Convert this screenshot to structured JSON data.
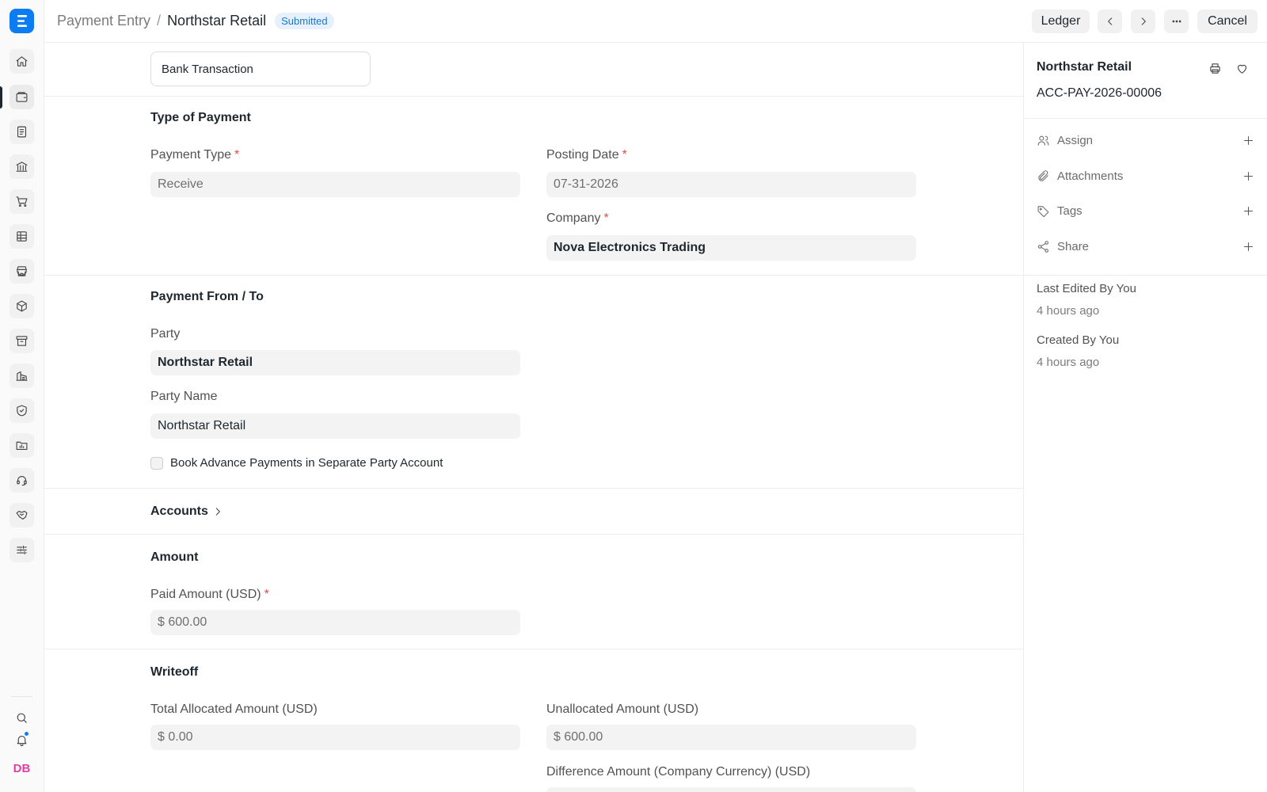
{
  "app": {
    "logo_letter": "E",
    "user_initials": "DB"
  },
  "rail": {
    "items": [
      {
        "icon": "home-icon"
      },
      {
        "icon": "wallet-icon"
      },
      {
        "icon": "document-icon"
      },
      {
        "icon": "bank-icon"
      },
      {
        "icon": "cart-icon"
      },
      {
        "icon": "table-icon"
      },
      {
        "icon": "store-icon"
      },
      {
        "icon": "package-icon"
      },
      {
        "icon": "archive-icon"
      },
      {
        "icon": "building-icon"
      },
      {
        "icon": "shield-icon"
      },
      {
        "icon": "folder-chart-icon"
      },
      {
        "icon": "headset-icon"
      },
      {
        "icon": "handshake-icon"
      },
      {
        "icon": "sliders-icon"
      }
    ],
    "bottom": [
      "search-icon",
      "bell-icon"
    ]
  },
  "header": {
    "breadcrumb_parent": "Payment Entry",
    "breadcrumb_separator": "/",
    "breadcrumb_current": "Northstar Retail",
    "status_badge": "Submitted",
    "ledger_label": "Ledger",
    "cancel_label": "Cancel"
  },
  "form": {
    "bank_transaction": "Bank Transaction",
    "type_of_payment": {
      "title": "Type of Payment",
      "payment_type_label": "Payment Type",
      "payment_type_value": "Receive",
      "posting_date_label": "Posting Date",
      "posting_date_value": "07-31-2026",
      "company_label": "Company",
      "company_value": "Nova Electronics Trading",
      "required_mark": "*"
    },
    "payment_from_to": {
      "title": "Payment From / To",
      "party_label": "Party",
      "party_value": "Northstar Retail",
      "party_name_label": "Party Name",
      "party_name_value": "Northstar Retail",
      "book_advance_label": "Book Advance Payments in Separate Party Account",
      "book_advance_checked": false
    },
    "accounts": {
      "title": "Accounts"
    },
    "amount": {
      "title": "Amount",
      "paid_amount_label": "Paid Amount (USD)",
      "paid_amount_value": "$ 600.00"
    },
    "writeoff": {
      "title": "Writeoff",
      "total_allocated_label": "Total Allocated Amount (USD)",
      "total_allocated_value": "$ 0.00",
      "unallocated_label": "Unallocated Amount (USD)",
      "unallocated_value": "$ 600.00",
      "difference_label": "Difference Amount (Company Currency) (USD)"
    }
  },
  "sidebar": {
    "title": "Northstar Retail",
    "doc_id": "ACC-PAY-2026-00006",
    "actions": [
      {
        "label": "Assign",
        "icon": "users-icon"
      },
      {
        "label": "Attachments",
        "icon": "paperclip-icon"
      },
      {
        "label": "Tags",
        "icon": "tag-icon"
      },
      {
        "label": "Share",
        "icon": "share-icon"
      }
    ],
    "last_edited": "Last Edited By You",
    "last_edited_time": "4 hours ago",
    "created": "Created By You",
    "created_time": "4 hours ago"
  },
  "colors": {
    "accent": "#0b7cf1",
    "badge_text": "#1579d0",
    "badge_bg": "#e6f1fd",
    "required": "#e24c4c",
    "avatar": "#e03fa3"
  }
}
